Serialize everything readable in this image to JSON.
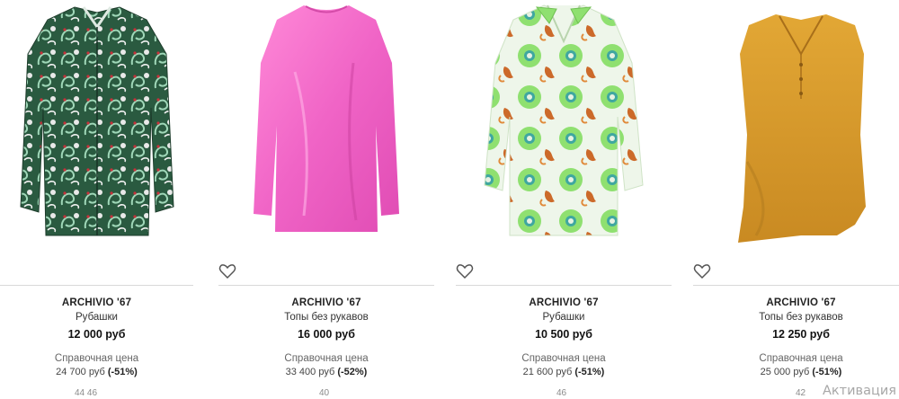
{
  "products": [
    {
      "brand": "ARCHIVIO '67",
      "category": "Рубашки",
      "price": "12 000 руб",
      "ref_label": "Справочная цена",
      "ref_price": "24 700 руб",
      "discount": "(-51%)",
      "sizes": "44 46",
      "image_icon": "paisley-shirt-image",
      "favorite_icon": "heart-icon"
    },
    {
      "brand": "ARCHIVIO '67",
      "category": "Топы без рукавов",
      "price": "16 000 руб",
      "ref_label": "Справочная цена",
      "ref_price": "33 400 руб",
      "discount": "(-52%)",
      "sizes": "40",
      "image_icon": "pink-satin-top-image",
      "favorite_icon": "heart-icon"
    },
    {
      "brand": "ARCHIVIO '67",
      "category": "Рубашки",
      "price": "10 500 руб",
      "ref_label": "Справочная цена",
      "ref_price": "21 600 руб",
      "discount": "(-51%)",
      "sizes": "46",
      "image_icon": "floral-shirt-image",
      "favorite_icon": "heart-icon"
    },
    {
      "brand": "ARCHIVIO '67",
      "category": "Топы без рукавов",
      "price": "12 250 руб",
      "ref_label": "Справочная цена",
      "ref_price": "25 000 руб",
      "discount": "(-51%)",
      "sizes": "42",
      "image_icon": "mustard-sleeveless-top-image",
      "favorite_icon": "heart-icon"
    }
  ],
  "watermark": "Активация",
  "colors": {
    "paisley_green": "#2f6b4a",
    "pink": "#f06fc8",
    "floral_green": "#8fe070",
    "floral_orange": "#cc6a2a",
    "mustard": "#d89a2a",
    "divider": "#d8d8d8"
  }
}
